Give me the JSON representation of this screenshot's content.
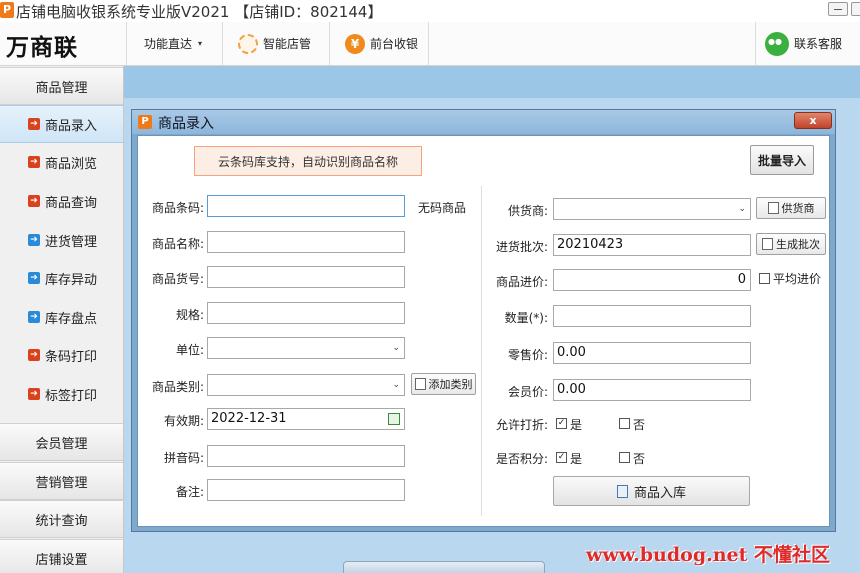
{
  "window": {
    "title": "店铺电脑收银系统专业版V2021 【店铺ID：802144】",
    "app_icon_glyph": "P",
    "close_glyph": "x"
  },
  "toolbar": {
    "brand": "万商联",
    "func_shortcut": "功能直达",
    "func_arrow": "▾",
    "smart_store": "智能店管",
    "front_cashier": "前台收银",
    "contact_service": "联系客服"
  },
  "sidebar": {
    "sections": [
      {
        "label": "商品管理"
      },
      {
        "label": "会员管理"
      },
      {
        "label": "营销管理"
      },
      {
        "label": "统计查询"
      },
      {
        "label": "店铺设置"
      }
    ],
    "items": [
      {
        "label": "商品录入",
        "icon": "arrow-right-icon",
        "color": "#d9421c",
        "active": true
      },
      {
        "label": "商品浏览",
        "icon": "arrow-right-icon",
        "color": "#d9421c"
      },
      {
        "label": "商品查询",
        "icon": "arrow-right-icon",
        "color": "#d9421c"
      },
      {
        "label": "进货管理",
        "icon": "arrow-right-icon",
        "color": "#2a8ad8"
      },
      {
        "label": "库存异动",
        "icon": "arrow-right-icon",
        "color": "#2a8ad8"
      },
      {
        "label": "库存盘点",
        "icon": "arrow-right-icon",
        "color": "#2a8ad8"
      },
      {
        "label": "条码打印",
        "icon": "arrow-right-icon",
        "color": "#d9421c"
      },
      {
        "label": "标签打印",
        "icon": "arrow-right-icon",
        "color": "#d9421c"
      }
    ],
    "item_arrow": "➔"
  },
  "dialog": {
    "title": "商品录入",
    "title_icon_glyph": "P",
    "close_glyph": "x",
    "cloud_tip": "云条码库支持，自动识别商品名称",
    "batch_import": "批量导入",
    "left": {
      "barcode_label": "商品条码:",
      "barcode_value": "",
      "no_barcode": "无码商品",
      "name_label": "商品名称:",
      "name_value": "",
      "sku_label": "商品货号:",
      "sku_value": "",
      "spec_label": "规格:",
      "spec_value": "",
      "unit_label": "单位:",
      "unit_value": "",
      "category_label": "商品类别:",
      "category_value": "",
      "add_category": "添加类别",
      "expiry_label": "有效期:",
      "expiry_value": "2022-12-31",
      "pinyin_label": "拼音码:",
      "pinyin_value": "",
      "remark_label": "备注:",
      "remark_value": ""
    },
    "right": {
      "supplier_label": "供货商:",
      "supplier_value": "",
      "supplier_btn": "供货商",
      "batch_label": "进货批次:",
      "batch_value": "20210423",
      "gen_batch_btn": "生成批次",
      "cost_label": "商品进价:",
      "cost_value": "0",
      "avg_cost_label": "平均进价",
      "qty_label": "数量(*):",
      "qty_value": "",
      "retail_label": "零售价:",
      "retail_value": "0.00",
      "member_price_label": "会员价:",
      "member_price_value": "0.00",
      "discount_label": "允许打折:",
      "discount_yes": "是",
      "discount_no": "否",
      "points_label": "是否积分:",
      "points_yes": "是",
      "points_no": "否",
      "stock_in_btn": "商品入库"
    },
    "check_glyph": "✓",
    "dropdown_glyph": "⌄"
  },
  "watermark": "www.budog.net 不懂社区"
}
